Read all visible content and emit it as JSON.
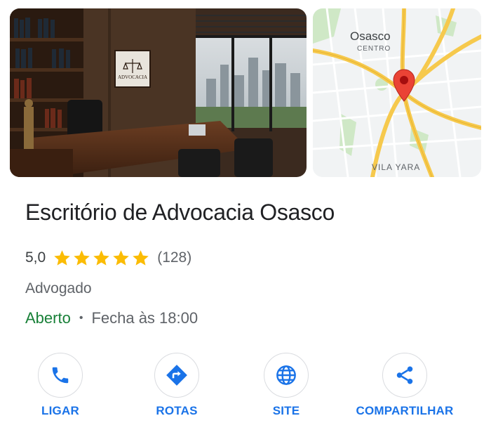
{
  "place": {
    "name": "Escritório de Advocacia Osasco",
    "rating": "5,0",
    "stars": 5,
    "review_count": "(128)",
    "category": "Advogado",
    "status": "Aberto",
    "separator": "•",
    "hours": "Fecha às 18:00"
  },
  "photo": {
    "sign_text": "ADVOCACIA"
  },
  "map": {
    "city": "Osasco",
    "district": "CENTRO",
    "neighborhood": "VILA YARA"
  },
  "actions": [
    {
      "label": "LIGAR",
      "icon": "phone-icon"
    },
    {
      "label": "ROTAS",
      "icon": "directions-icon"
    },
    {
      "label": "SITE",
      "icon": "globe-icon"
    },
    {
      "label": "COMPARTILHAR",
      "icon": "share-icon"
    }
  ],
  "colors": {
    "accent": "#1a73e8",
    "open": "#188038",
    "star": "#fbbc04",
    "pin": "#ea4335"
  }
}
